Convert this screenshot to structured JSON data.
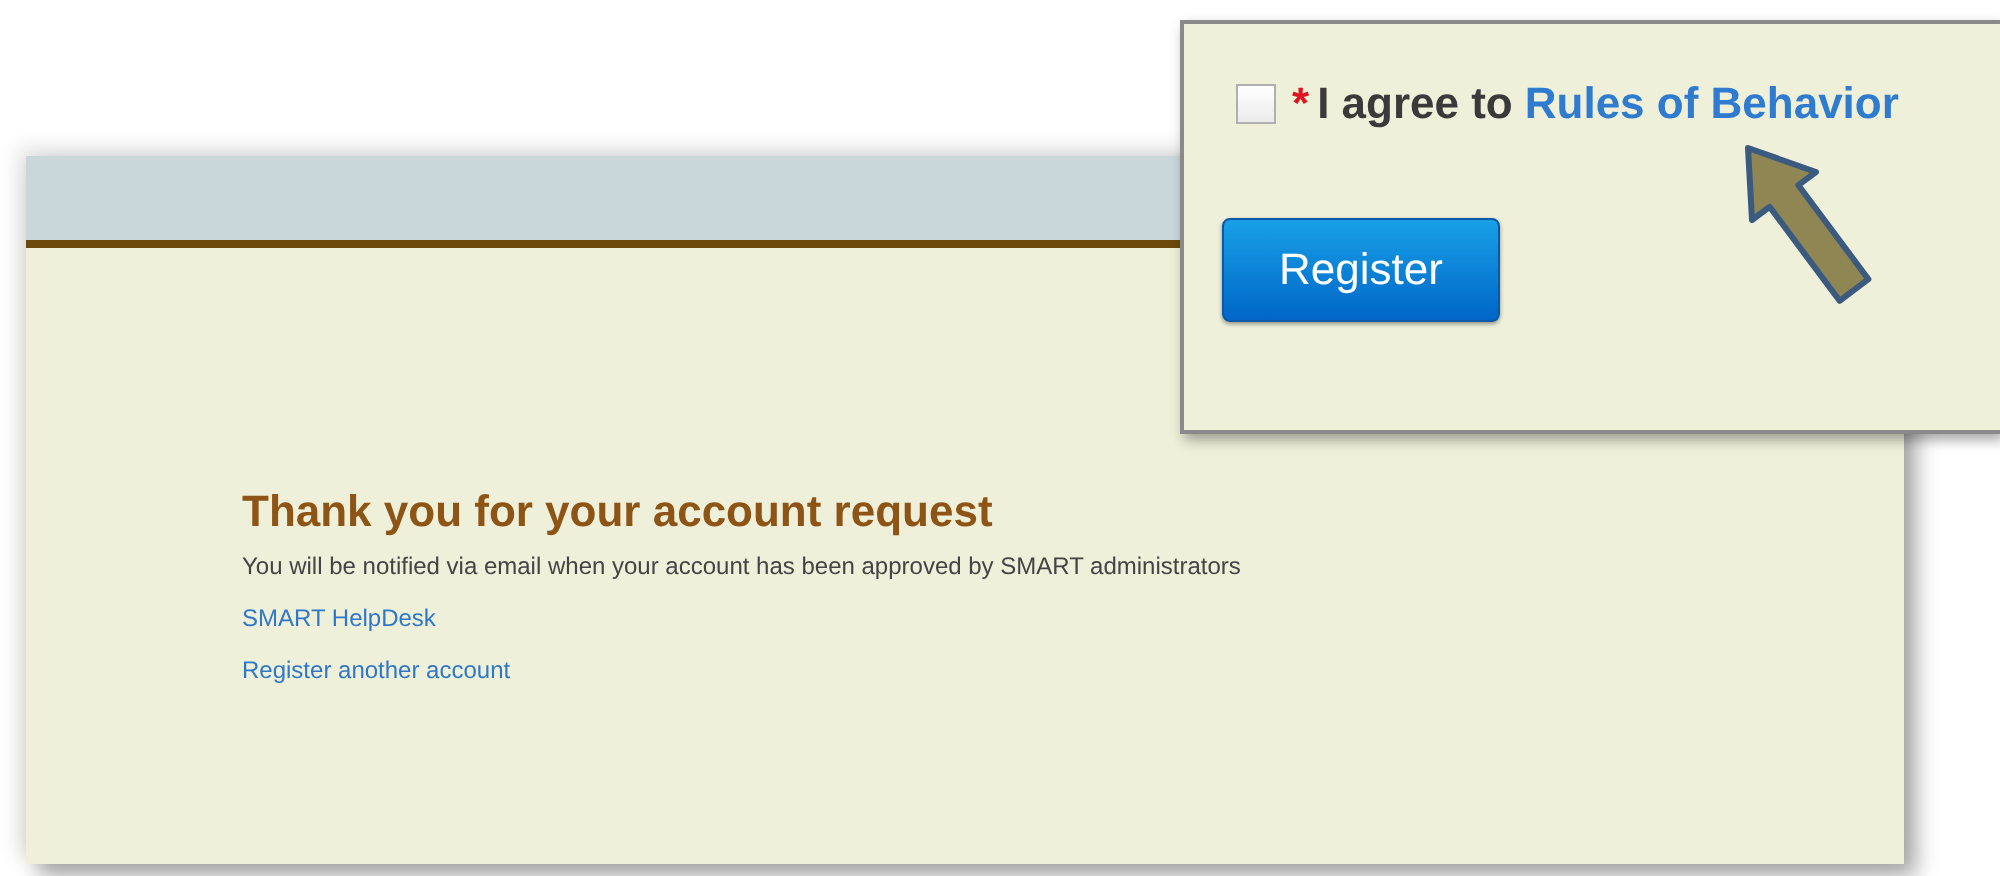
{
  "page": {
    "heading": "Thank you for your account request",
    "message": "You will be notified via email when your account has been approved by SMART administrators",
    "links": [
      "SMART HelpDesk",
      "Register another account"
    ]
  },
  "callout": {
    "agree": {
      "checked": false,
      "required_mark": "*",
      "label": "I agree to",
      "link": "Rules of Behavior"
    },
    "register_button": "Register"
  }
}
